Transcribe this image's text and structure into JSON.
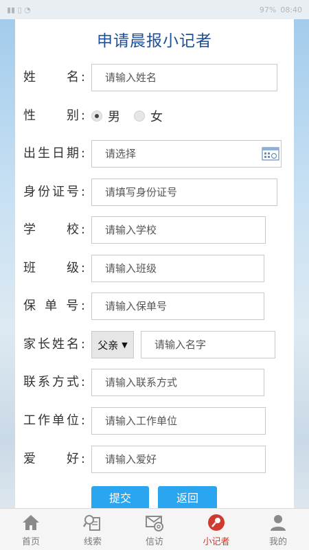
{
  "status_bar": {
    "battery": "97%",
    "time": "08:40"
  },
  "page": {
    "title": "申请晨报小记者",
    "fields": {
      "name": {
        "label": "姓　　名:",
        "placeholder": "请输入姓名"
      },
      "gender": {
        "label": "性　　别:",
        "options": [
          "男",
          "女"
        ],
        "selected": "男"
      },
      "birthday": {
        "label": "出生日期:",
        "placeholder": "请选择"
      },
      "id_number": {
        "label": "身份证号:",
        "placeholder": "请填写身份证号"
      },
      "school": {
        "label": "学　　校:",
        "placeholder": "请输入学校"
      },
      "class": {
        "label": "班　　级:",
        "placeholder": "请输入班级"
      },
      "policy_number": {
        "label": "保 单 号:",
        "placeholder": "请输入保单号"
      },
      "parent_name": {
        "label": "家长姓名:",
        "relation": "父亲",
        "placeholder": "请输入名字"
      },
      "contact": {
        "label": "联系方式:",
        "placeholder": "请输入联系方式"
      },
      "workplace": {
        "label": "工作单位:",
        "placeholder": "请输入工作单位"
      },
      "hobby": {
        "label": "爱　　好:",
        "placeholder": "请输入爱好"
      }
    },
    "buttons": {
      "submit": "提交",
      "back": "返回"
    }
  },
  "tabbar": {
    "items": [
      {
        "label": "首页",
        "icon": "home-icon"
      },
      {
        "label": "线索",
        "icon": "search-document-icon"
      },
      {
        "label": "信访",
        "icon": "mail-at-icon"
      },
      {
        "label": "小记者",
        "icon": "microphone-icon",
        "active": true
      },
      {
        "label": "我的",
        "icon": "user-icon"
      }
    ]
  },
  "colors": {
    "title": "#1e4f97",
    "button": "#29a6ef",
    "active_tab": "#d13a2f"
  }
}
